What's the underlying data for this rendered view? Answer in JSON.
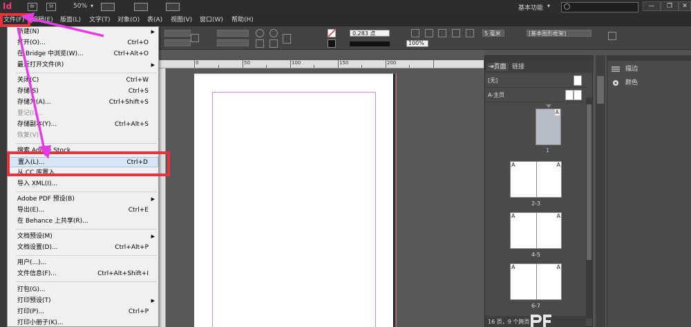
{
  "appbar": {
    "logo": "Id",
    "bridge_icon": "Br",
    "stock_icon": "St",
    "zoom": "50%",
    "workspace": "基本功能",
    "icons": [
      "indesign-logo-icon",
      "bridge-icon",
      "stock-icon",
      "view-options-icon",
      "screen-mode-icon",
      "arrange-documents-icon"
    ],
    "window_controls": [
      "—",
      "❐",
      "✕"
    ]
  },
  "menubar": {
    "items": [
      "文件(F)",
      "编辑(E)",
      "版面(L)",
      "文字(T)",
      "对象(O)",
      "表(A)",
      "视图(V)",
      "窗口(W)",
      "帮助(H)"
    ]
  },
  "toolbar": {
    "stroke_weight": "0.283 点",
    "zoom_pct": "100%",
    "columns": "5 毫米",
    "style": "[基本图形框架]"
  },
  "ruler": {
    "labels": [
      "0",
      "50",
      "100",
      "150",
      "200"
    ]
  },
  "file_menu": {
    "items": [
      {
        "label": "新建(N)",
        "shortcut": "",
        "submenu": true,
        "disabled": false
      },
      {
        "label": "打开(O)...",
        "shortcut": "Ctrl+O",
        "submenu": false,
        "disabled": false
      },
      {
        "label": "在 Bridge 中浏览(W)...",
        "shortcut": "Ctrl+Alt+O",
        "submenu": false,
        "disabled": false
      },
      {
        "label": "最近打开文件(R)",
        "shortcut": "",
        "submenu": true,
        "disabled": false
      },
      {
        "label": "关闭(C)",
        "shortcut": "Ctrl+W",
        "submenu": false,
        "disabled": false
      },
      {
        "label": "存储(S)",
        "shortcut": "Ctrl+S",
        "submenu": false,
        "disabled": false
      },
      {
        "label": "存储为(A)...",
        "shortcut": "Ctrl+Shift+S",
        "submenu": false,
        "disabled": false
      },
      {
        "label": "登记(I)...",
        "shortcut": "",
        "submenu": false,
        "disabled": true
      },
      {
        "label": "存储副本(Y)...",
        "shortcut": "Ctrl+Alt+S",
        "submenu": false,
        "disabled": false
      },
      {
        "label": "恢复(V)",
        "shortcut": "",
        "submenu": false,
        "disabled": true
      },
      {
        "label": "搜索 Adobe Stock...",
        "shortcut": "",
        "submenu": false,
        "disabled": false
      },
      {
        "label": "置入(L)...",
        "shortcut": "Ctrl+D",
        "submenu": false,
        "disabled": false
      },
      {
        "label": "从 CC 库置入",
        "shortcut": "",
        "submenu": false,
        "disabled": false
      },
      {
        "label": "导入 XML(I)...",
        "shortcut": "",
        "submenu": false,
        "disabled": false
      },
      {
        "label": "Adobe PDF 预设(B)",
        "shortcut": "",
        "submenu": true,
        "disabled": false
      },
      {
        "label": "导出(E)...",
        "shortcut": "Ctrl+E",
        "submenu": false,
        "disabled": false
      },
      {
        "label": "在 Behance 上共享(R)...",
        "shortcut": "",
        "submenu": false,
        "disabled": false
      },
      {
        "label": "文档预设(M)",
        "shortcut": "",
        "submenu": true,
        "disabled": false
      },
      {
        "label": "文档设置(D)...",
        "shortcut": "Ctrl+Alt+P",
        "submenu": false,
        "disabled": false
      },
      {
        "label": "用户(...)...",
        "shortcut": "",
        "submenu": false,
        "disabled": false
      },
      {
        "label": "文件信息(F)...",
        "shortcut": "Ctrl+Alt+Shift+I",
        "submenu": false,
        "disabled": false
      },
      {
        "label": "打包(G)...",
        "shortcut": "",
        "submenu": false,
        "disabled": false
      },
      {
        "label": "打印预设(T)",
        "shortcut": "",
        "submenu": true,
        "disabled": false
      },
      {
        "label": "打印(P)...",
        "shortcut": "Ctrl+P",
        "submenu": false,
        "disabled": false
      },
      {
        "label": "打印小册子(K)...",
        "shortcut": "",
        "submenu": false,
        "disabled": false
      }
    ]
  },
  "pages_panel": {
    "tabs": [
      "页面",
      "链接"
    ],
    "masters": [
      "[无]",
      "A-主页"
    ],
    "first_page_label": "1",
    "spreads": [
      "2-3",
      "4-5",
      "6-7"
    ],
    "master_prefix": "A",
    "footer": "16 页，9 个跨页"
  },
  "side_panel": {
    "items": [
      "描边",
      "颜色"
    ]
  },
  "colors": {
    "highlight_box": "#e8323c",
    "arrow": "#e63ce6",
    "menu_bg": "#f0f0f0",
    "app_bg": "#535353"
  }
}
